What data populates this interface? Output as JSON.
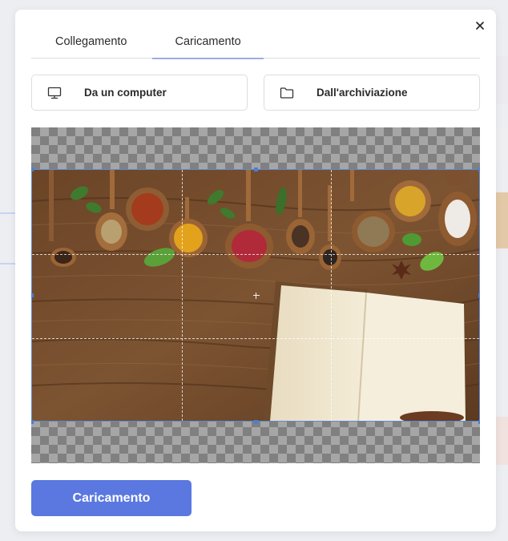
{
  "dialog": {
    "tabs": [
      {
        "label": "Collegamento",
        "active": false
      },
      {
        "label": "Caricamento",
        "active": true
      }
    ],
    "sources": [
      {
        "label": "Da un computer",
        "icon": "monitor-icon"
      },
      {
        "label": "Dall'archiviazione",
        "icon": "folder-icon"
      }
    ],
    "upload_label": "Caricamento",
    "close_icon": "close-icon"
  },
  "colors": {
    "accent": "#5a78e0",
    "tab_underline": "#4d6bd6",
    "crop_border": "#5b8ad8",
    "border": "#dcdde2"
  },
  "image": {
    "subject": "spices in wooden spoons on a wooden table with an open blank book"
  }
}
